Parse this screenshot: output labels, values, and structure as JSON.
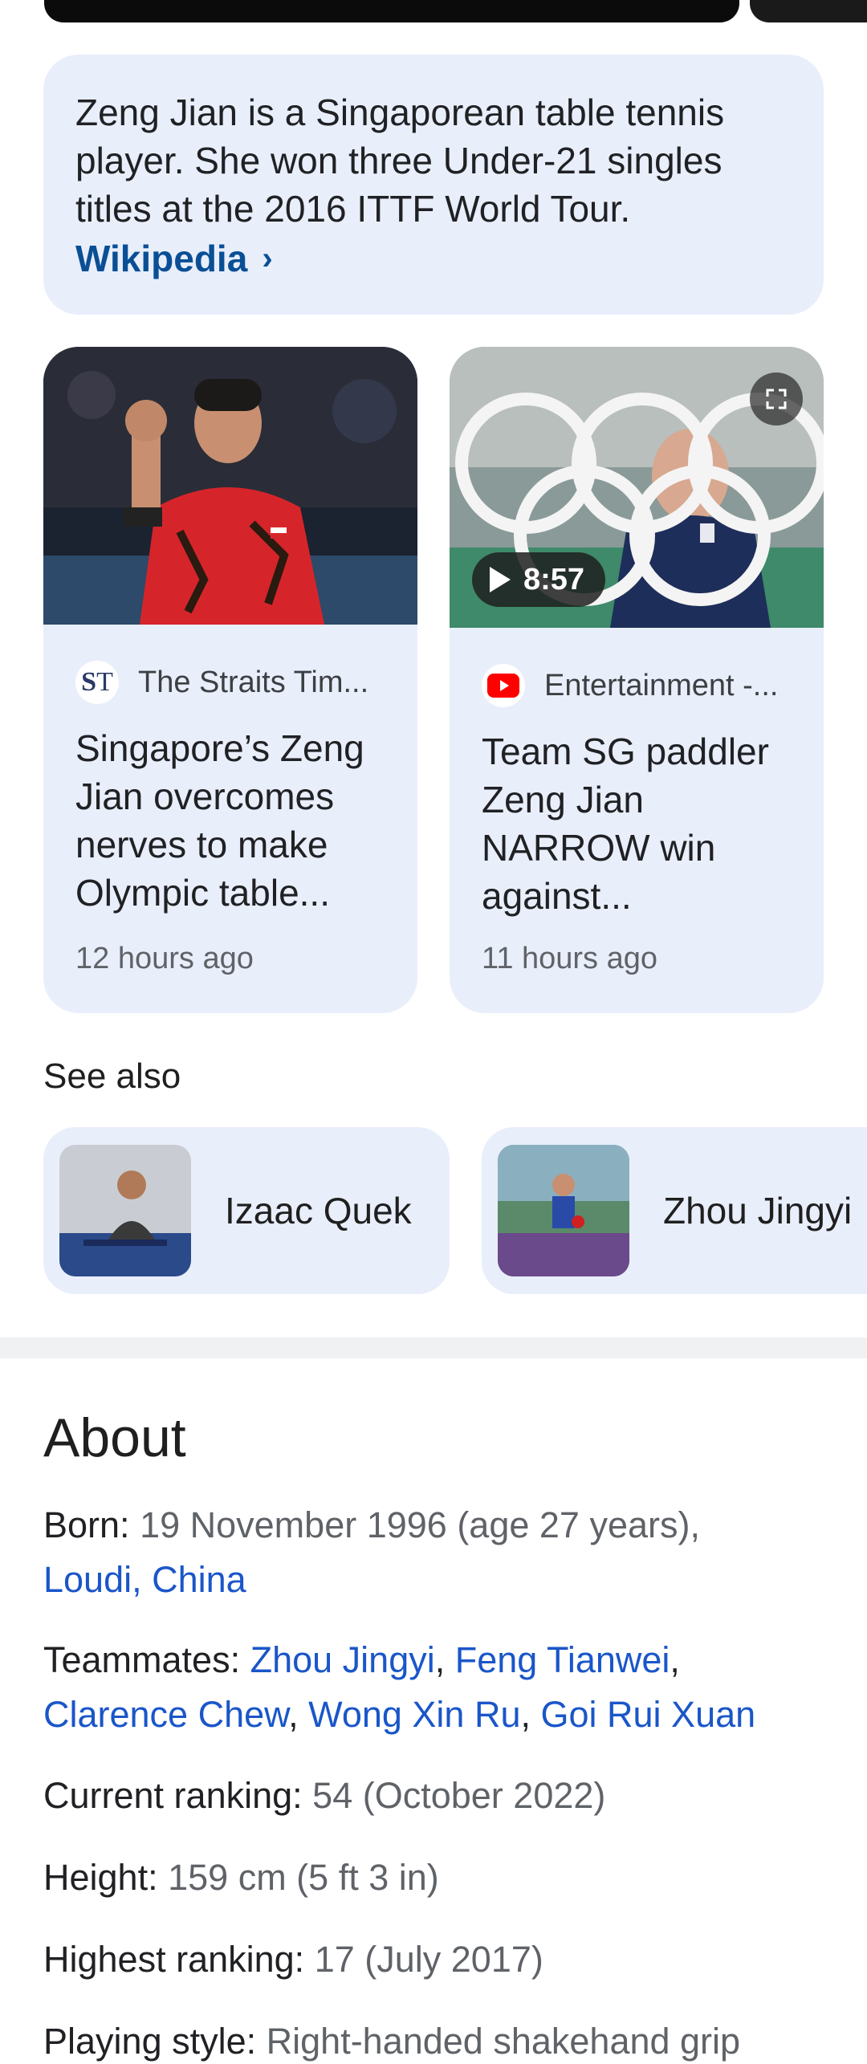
{
  "summary": {
    "text": "Zeng Jian is a Singaporean table tennis player. She won three Under-21 singles titles at the 2016 ITTF World Tour.",
    "source_link": "Wikipedia"
  },
  "news": [
    {
      "source": "The Straits Tim...",
      "source_logo": "ST",
      "headline": "Singapore’s Zeng Jian overcomes nerves to make Olympic table...",
      "time": "12 hours ago"
    },
    {
      "source": "Entertainment -...",
      "source_logo": "youtube-icon",
      "headline": "Team SG paddler Zeng Jian NARROW win against...",
      "time": "11 hours ago",
      "video_duration": "8:57"
    }
  ],
  "see_also": {
    "title": "See also",
    "items": [
      {
        "label": "Izaac Quek"
      },
      {
        "label": "Zhou Jingyi"
      }
    ]
  },
  "about": {
    "title": "About",
    "born_label": "Born:",
    "born_value": "19 November 1996 (age 27 years),",
    "born_place": "Loudi, China",
    "teammates_label": "Teammates:",
    "teammates": [
      "Zhou Jingyi",
      "Feng Tianwei",
      "Clarence Chew",
      "Wong Xin Ru",
      "Goi Rui Xuan"
    ],
    "ranking_label": "Current ranking:",
    "ranking_value": "54 (October 2022)",
    "height_label": "Height:",
    "height_value": "159 cm (5 ft 3 in)",
    "highest_label": "Highest ranking:",
    "highest_value": "17 (July 2017)",
    "style_label": "Playing style:",
    "style_value": "Right-handed shakehand grip"
  },
  "colors": {
    "card_bg": "#e9eefb",
    "link": "#1a56c9",
    "wiki_link": "#0a4f95"
  }
}
